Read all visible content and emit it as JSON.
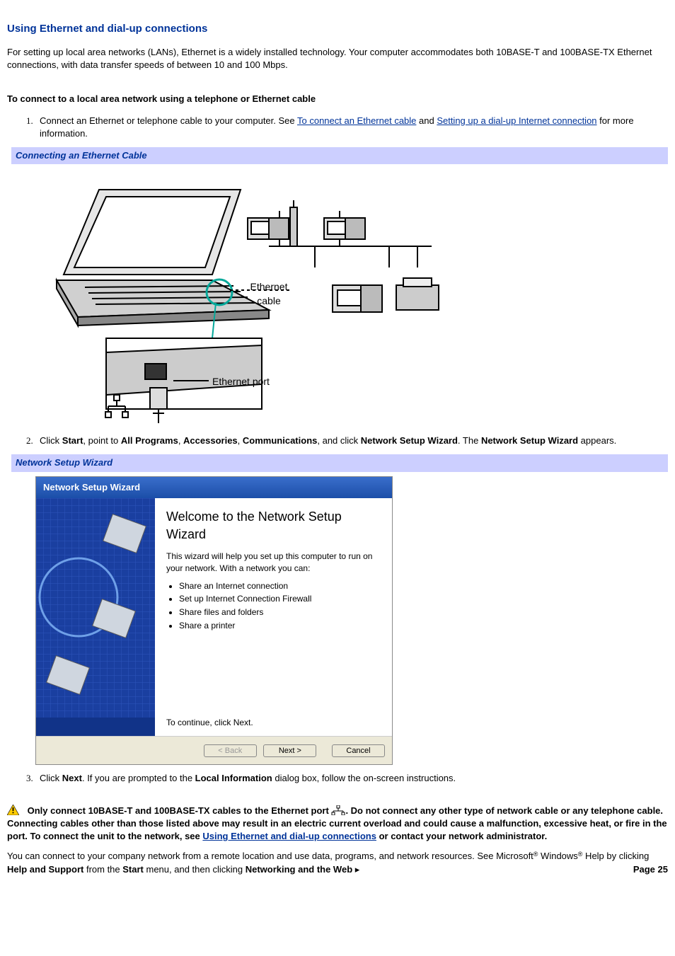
{
  "title": "Using Ethernet and dial-up connections",
  "intro": "For setting up local area networks (LANs), Ethernet is a widely installed technology. Your computer accommodates both 10BASE-T and 100BASE-TX Ethernet connections, with data transfer speeds of between 10 and 100 Mbps.",
  "sub1": "To connect to a local area network using a telephone or Ethernet cable",
  "step1": {
    "pre": "Connect an Ethernet or telephone cable to your computer. See ",
    "link1": "To connect an Ethernet cable",
    "mid": " and ",
    "link2": "Setting up a dial-up Internet connection",
    "post": " for more information."
  },
  "fig1_title": "Connecting an Ethernet Cable",
  "fig1_labels": {
    "cable_line1": "Ethernet",
    "cable_line2": "cable",
    "port": "Ethernet port"
  },
  "step2": {
    "pre": "Click ",
    "b1": "Start",
    "t2": ", point to ",
    "b2": "All Programs",
    "t3": ", ",
    "b3": "Accessories",
    "t4": ", ",
    "b4": "Communications",
    "t5": ", and click ",
    "b5": "Network Setup Wizard",
    "t6": ". The ",
    "b6": "Network Setup Wizard",
    "t7": " appears."
  },
  "fig2_title": "Network Setup Wizard",
  "wizard": {
    "titlebar": "Network Setup Wizard",
    "heading": "Welcome to the Network Setup Wizard",
    "desc": "This wizard will help you set up this computer to run on your network. With a network you can:",
    "bullets": [
      "Share an Internet connection",
      "Set up Internet Connection Firewall",
      "Share files and folders",
      "Share a printer"
    ],
    "continue": "To continue, click Next.",
    "back": "< Back",
    "next": "Next >",
    "cancel": "Cancel"
  },
  "step3": {
    "pre": "Click ",
    "b1": "Next",
    "t2": ". If you are prompted to the ",
    "b2": "Local Information",
    "t3": " dialog box, follow the on-screen instructions."
  },
  "warning": {
    "pre": "Only connect 10BASE-T and 100BASE-TX cables to the Ethernet port ",
    "post1": ". Do not connect any other type of network cable or any telephone cable. Connecting cables other than those listed above may result in an electric current overload and could cause a malfunction, excessive heat, or fire in the port. To connect the unit to the network, see ",
    "link": "Using Ethernet and dial-up connections",
    "post2": " or contact your network administrator."
  },
  "closing": {
    "pre": "You can connect to your company network from a remote location and use data, programs, and network resources. See Microsoft",
    "reg1": "®",
    "mid1": " Windows",
    "reg2": "®",
    "mid2": " Help by clicking ",
    "b1": "Help and Support",
    "mid3": " from the ",
    "b2": "Start",
    "mid4": " menu, and then clicking ",
    "b3": "Networking and the Web",
    "trail": " ▸"
  },
  "page_num": "Page 25"
}
